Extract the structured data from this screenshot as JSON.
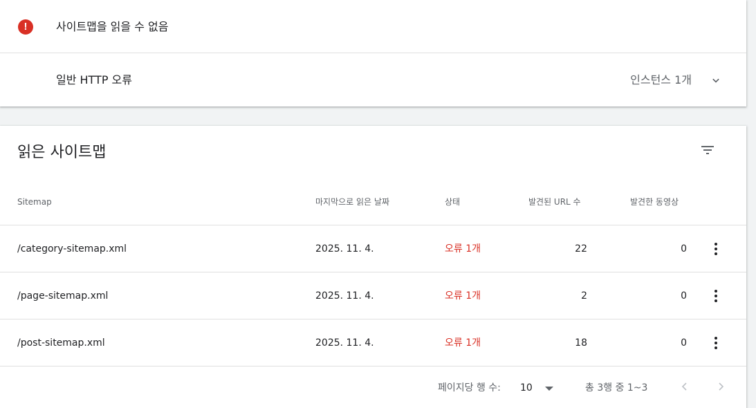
{
  "error_card": {
    "title": "사이트맵을 읽을 수 없음",
    "error_type": "일반 HTTP 오류",
    "instance_count": "인스턴스 1개"
  },
  "sitemaps_card": {
    "title": "읽은 사이트맵",
    "columns": {
      "sitemap": "Sitemap",
      "last_read": "마지막으로 읽은 날짜",
      "status": "상태",
      "urls": "발견된 URL 수",
      "videos": "발견한 동영상"
    },
    "rows": [
      {
        "path": "/category-sitemap.xml",
        "date": "2025. 11. 4.",
        "status": "오류 1개",
        "urls": "22",
        "videos": "0"
      },
      {
        "path": "/page-sitemap.xml",
        "date": "2025. 11. 4.",
        "status": "오류 1개",
        "urls": "2",
        "videos": "0"
      },
      {
        "path": "/post-sitemap.xml",
        "date": "2025. 11. 4.",
        "status": "오류 1개",
        "urls": "18",
        "videos": "0"
      }
    ],
    "pagination": {
      "rows_per_page_label": "페이지당 행 수:",
      "rows_per_page": "10",
      "range": "총 3행 중 1~3"
    }
  },
  "icons": {
    "error": "error-icon",
    "expand": "chevron-down-icon",
    "filter": "filter-icon",
    "more": "more-vert-icon",
    "prev": "chevron-left-icon",
    "next": "chevron-right-icon"
  },
  "colors": {
    "error": "#d93025",
    "text": "#202124",
    "secondary": "#5f6368",
    "divider": "#e0e0e0"
  }
}
